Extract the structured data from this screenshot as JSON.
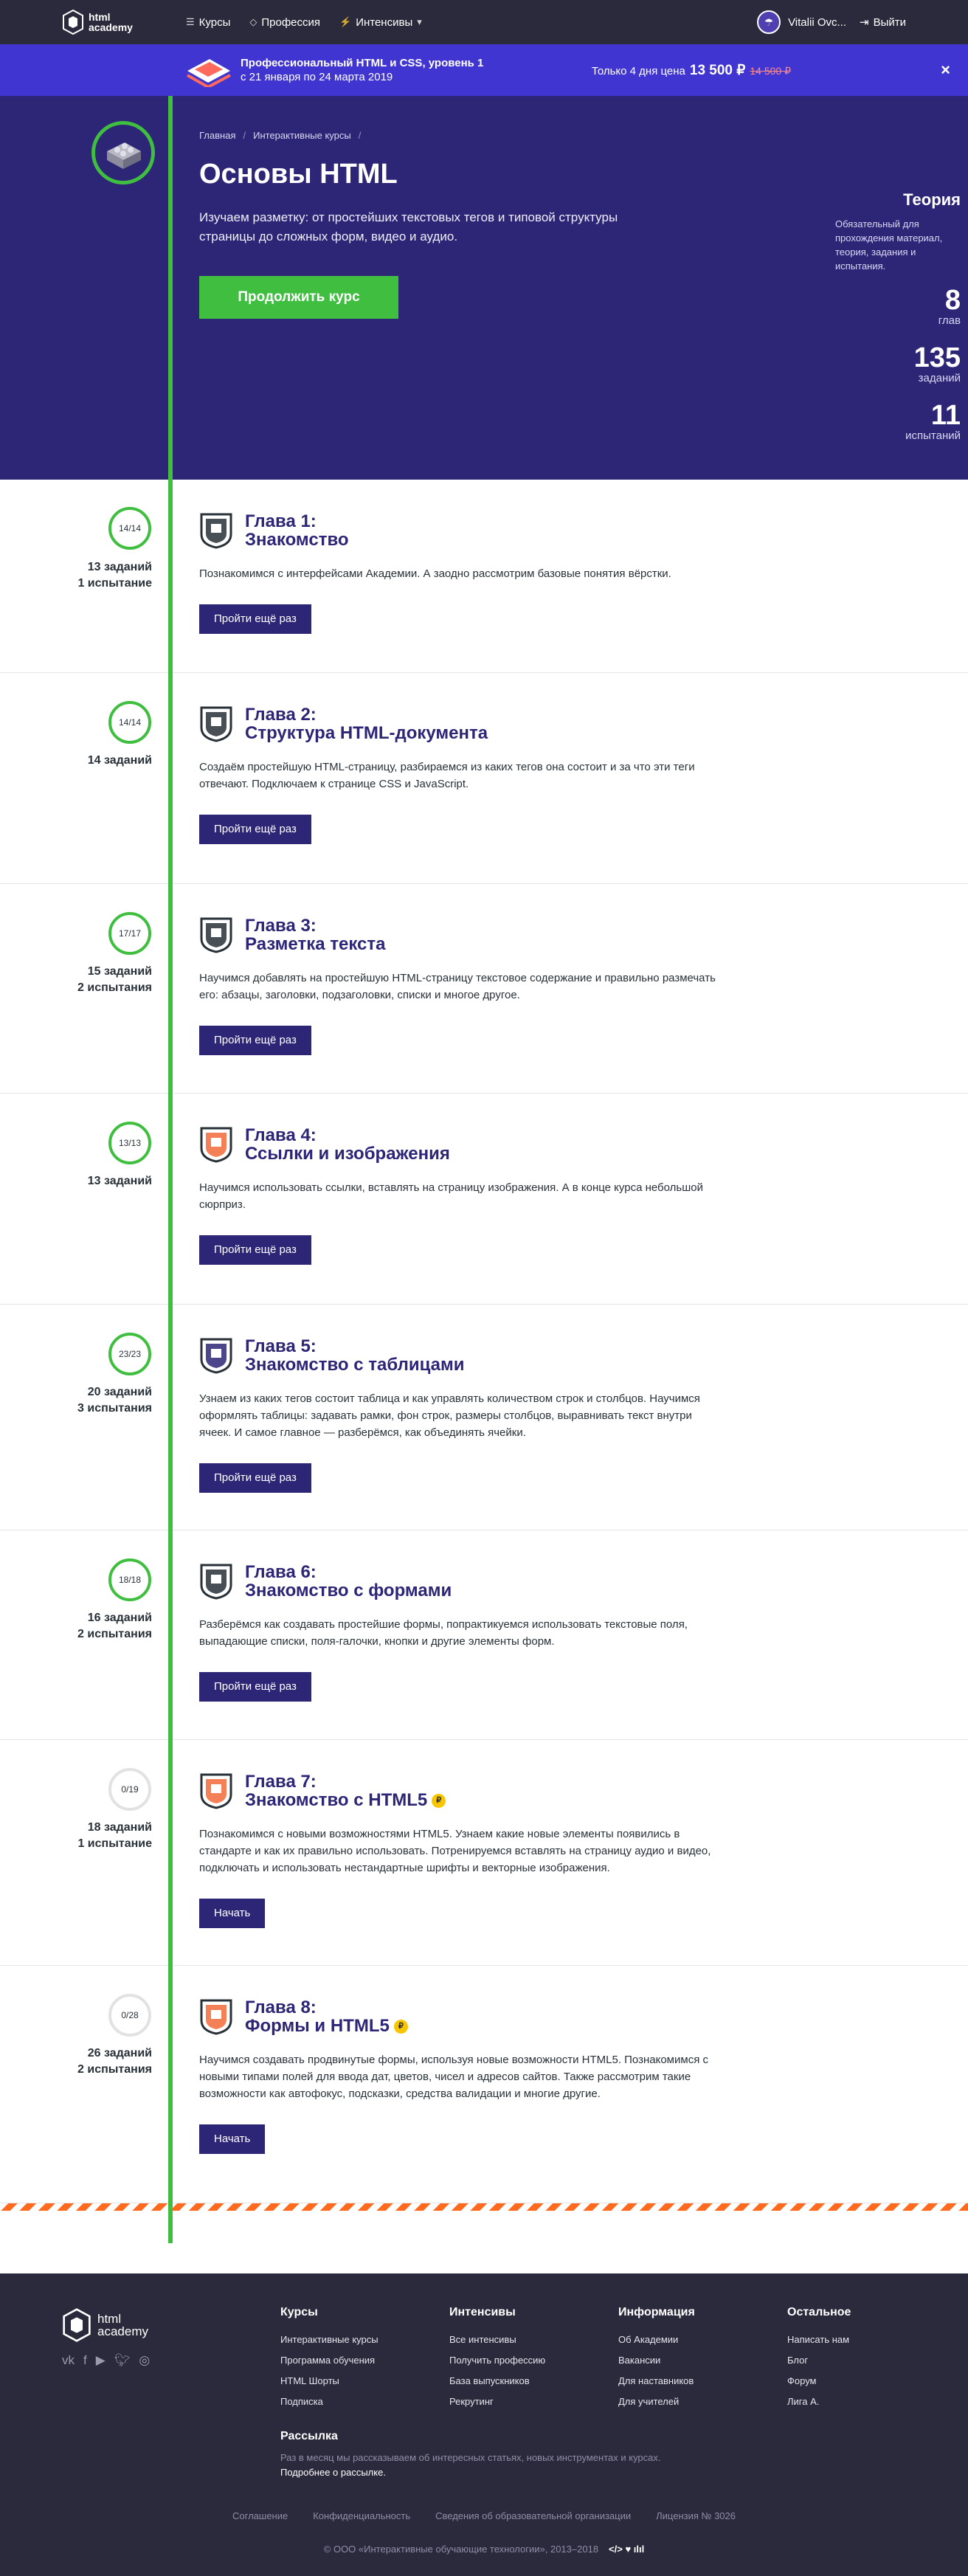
{
  "header": {
    "logo_line1": "html",
    "logo_line2": "academy",
    "nav": [
      {
        "label": "Курсы",
        "icon": "menu-icon"
      },
      {
        "label": "Профессия",
        "icon": "diamond-icon"
      },
      {
        "label": "Интенсивы",
        "icon": "lightning-icon"
      }
    ],
    "user_name": "Vitalii Ovc...",
    "logout_label": "Выйти"
  },
  "promo": {
    "title": "Профессиональный HTML и CSS, уровень 1",
    "dates": "с 21 января по 24 марта 2019",
    "price_prefix": "Только 4 дня цена",
    "price_now": "13 500 ₽",
    "price_old": "14 500 ₽",
    "close": "×"
  },
  "course": {
    "breadcrumb": [
      "Главная",
      "Интерактивные курсы"
    ],
    "title": "Основы HTML",
    "lead": "Изучаем разметку: от простейших текстовых тегов и типовой структуры страницы до сложных форм, видео и аудио.",
    "cta": "Продолжить курс",
    "theory_title": "Теория",
    "theory_desc": "Обязательный для прохождения материал, теория, задания и испытания.",
    "stats": [
      {
        "n": "8",
        "l": "глав"
      },
      {
        "n": "135",
        "l": "заданий"
      },
      {
        "n": "11",
        "l": "испытаний"
      }
    ]
  },
  "chapters": [
    {
      "progress": "14/14",
      "stats": [
        "13 заданий",
        "1 испытание"
      ],
      "title1": "Глава 1:",
      "title2": "Знакомство",
      "coin": "",
      "desc": "Познакомимся с интерфейсами Академии. А заодно рассмотрим базовые понятия вёрстки.",
      "button": "Пройти ещё раз",
      "done": true,
      "icon": "shield-icon"
    },
    {
      "progress": "14/14",
      "stats": [
        "14 заданий"
      ],
      "title1": "Глава 2:",
      "title2": "Структура HTML-документа",
      "coin": "",
      "desc": "Создаём простейшую HTML-страницу, разбираемся из каких тегов она состоит и за что эти теги отвечают. Подключаем к странице CSS и JavaScript.",
      "button": "Пройти ещё раз",
      "done": true,
      "icon": "document-icon"
    },
    {
      "progress": "17/17",
      "stats": [
        "15 заданий",
        "2 испытания"
      ],
      "title1": "Глава 3:",
      "title2": "Разметка текста",
      "coin": "",
      "desc": "Научимся добавлять на простейшую HTML-страницу текстовое содержание и правильно размечать его: абзацы, заголовки, подзаголовки, списки и многое другое.",
      "button": "Пройти ещё раз",
      "done": true,
      "icon": "pen-icon"
    },
    {
      "progress": "13/13",
      "stats": [
        "13 заданий"
      ],
      "title1": "Глава 4:",
      "title2": "Ссылки и изображения",
      "coin": "",
      "desc": "Научимся использовать ссылки, вставлять на страницу изображения. А в конце курса небольшой сюрприз.",
      "button": "Пройти ещё раз",
      "done": true,
      "icon": "fox-icon"
    },
    {
      "progress": "23/23",
      "stats": [
        "20 заданий",
        "3 испытания"
      ],
      "title1": "Глава 5:",
      "title2": "Знакомство с таблицами",
      "coin": "",
      "desc": "Узнаем из каких тегов состоит таблица и как управлять количеством строк и столбцов. Научимся оформлять таблицы: задавать рамки, фон строк, размеры столбцов, выравнивать текст внутри ячеек. И самое главное — разберёмся, как объединять ячейки.",
      "button": "Пройти ещё раз",
      "done": true,
      "icon": "table-icon"
    },
    {
      "progress": "18/18",
      "stats": [
        "16 заданий",
        "2 испытания"
      ],
      "title1": "Глава 6:",
      "title2": "Знакомство с формами",
      "coin": "",
      "desc": "Разберёмся как создавать простейшие формы, попрактикуемся использовать текстовые поля, выпадающие списки, поля-галочки, кнопки и другие элементы форм.",
      "button": "Пройти ещё раз",
      "done": true,
      "icon": "form-icon"
    },
    {
      "progress": "0/19",
      "stats": [
        "18 заданий",
        "1 испытание"
      ],
      "title1": "Глава 7:",
      "title2": "Знакомство с HTML5",
      "coin": "₽",
      "desc": "Познакомимся с новыми возможностями HTML5. Узнаем какие новые элементы появились в стандарте и как их правильно использовать. Потренируемся вставлять на страницу аудио и видео, подключать и использовать нестандартные шрифты и векторные изображения.",
      "button": "Начать",
      "done": false,
      "icon": "html5-icon"
    },
    {
      "progress": "0/28",
      "stats": [
        "26 заданий",
        "2 испытания"
      ],
      "title1": "Глава 8:",
      "title2": "Формы и HTML5",
      "coin": "₽",
      "desc": "Научимся создавать продвинутые формы, используя новые возможности HTML5. Познакомимся с новыми типами полей для ввода дат, цветов, чисел и адресов сайтов. Также рассмотрим такие возможности как автофокус, подсказки, средства валидации и многие другие.",
      "button": "Начать",
      "done": false,
      "icon": "forms-html5-icon"
    }
  ],
  "footer": {
    "logo_line1": "html",
    "logo_line2": "academy",
    "social": [
      "vk-icon",
      "facebook-icon",
      "youtube-icon",
      "twitter-icon",
      "instagram-icon"
    ],
    "columns": [
      {
        "title": "Курсы",
        "links": [
          "Интерактивные курсы",
          "Программа обучения",
          "HTML Шорты",
          "Подписка"
        ]
      },
      {
        "title": "Интенсивы",
        "links": [
          "Все интенсивы",
          "Получить профессию",
          "База выпускников",
          "Рекрутинг"
        ]
      },
      {
        "title": "Информация",
        "links": [
          "Об Академии",
          "Вакансии",
          "Для наставников",
          "Для учителей"
        ]
      },
      {
        "title": "Остальное",
        "links": [
          "Написать нам",
          "Блог",
          "Форум",
          "Лига А."
        ]
      }
    ],
    "news_title": "Рассылка",
    "news_text": "Раз в месяц мы рассказываем об интересных статьях, новых инструментах и курсах.",
    "news_link": "Подробнее о рассылке.",
    "legal": [
      "Соглашение",
      "Конфиденциальность",
      "Сведения об образовательной организации",
      "Лицензия № 3026"
    ],
    "copyright": "© ООО «Интерактивные обучающие технологии», 2013–2018",
    "brand_mark": "</> ♥ ılıl"
  }
}
